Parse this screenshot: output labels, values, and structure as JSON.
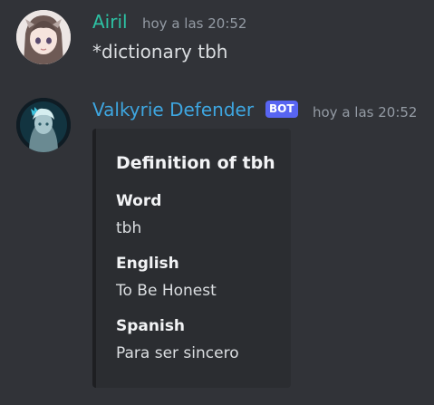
{
  "messages": [
    {
      "author": "Airil",
      "author_color": "#2dc1a3",
      "timestamp": "hoy a las 20:52",
      "content": "*dictionary tbh"
    },
    {
      "author": "Valkyrie Defender",
      "author_color": "#3ea6e0",
      "badge": "BOT",
      "badge_color": "#5865f2",
      "timestamp": "hoy a las 20:52",
      "embed": {
        "title": "Definition of tbh",
        "fields": [
          {
            "name": "Word",
            "value": "tbh"
          },
          {
            "name": "English",
            "value": "To Be Honest"
          },
          {
            "name": "Spanish",
            "value": "Para ser sincero"
          }
        ]
      }
    }
  ]
}
